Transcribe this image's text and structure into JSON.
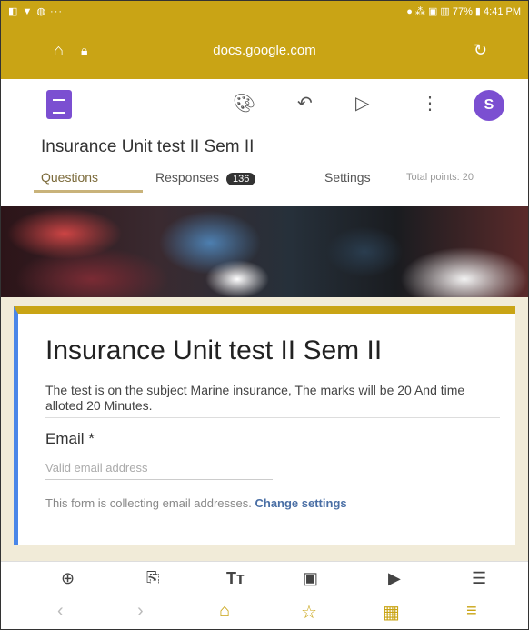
{
  "status_bar": {
    "left": "◧ ▼ ◍ ···",
    "right": "● ⁂ ▣ ▥ 77% ▮ 4:41 PM"
  },
  "browser": {
    "url": "docs.google.com",
    "home_icon": "home-icon",
    "lock_icon": "lock-icon",
    "refresh_icon": "refresh-icon"
  },
  "app": {
    "form_title": "Insurance Unit test II Sem II",
    "tabs": {
      "questions": "Questions",
      "responses": "Responses",
      "responses_count": "136",
      "settings": "Settings"
    },
    "total_points": "Total points: 20",
    "avatar_letter": "S"
  },
  "card": {
    "title": "Insurance Unit test II Sem II",
    "description": "The test is on the subject Marine insurance, The marks will be 20 And time alloted 20 Minutes.",
    "email_label": "Email *",
    "email_placeholder": "Valid email address",
    "note_text": "This form is collecting email addresses.",
    "note_link": "Change settings"
  },
  "colors": {
    "browser_bar": "#c9a415",
    "accent": "#7b4fd1",
    "card_left": "#4a86e8"
  }
}
